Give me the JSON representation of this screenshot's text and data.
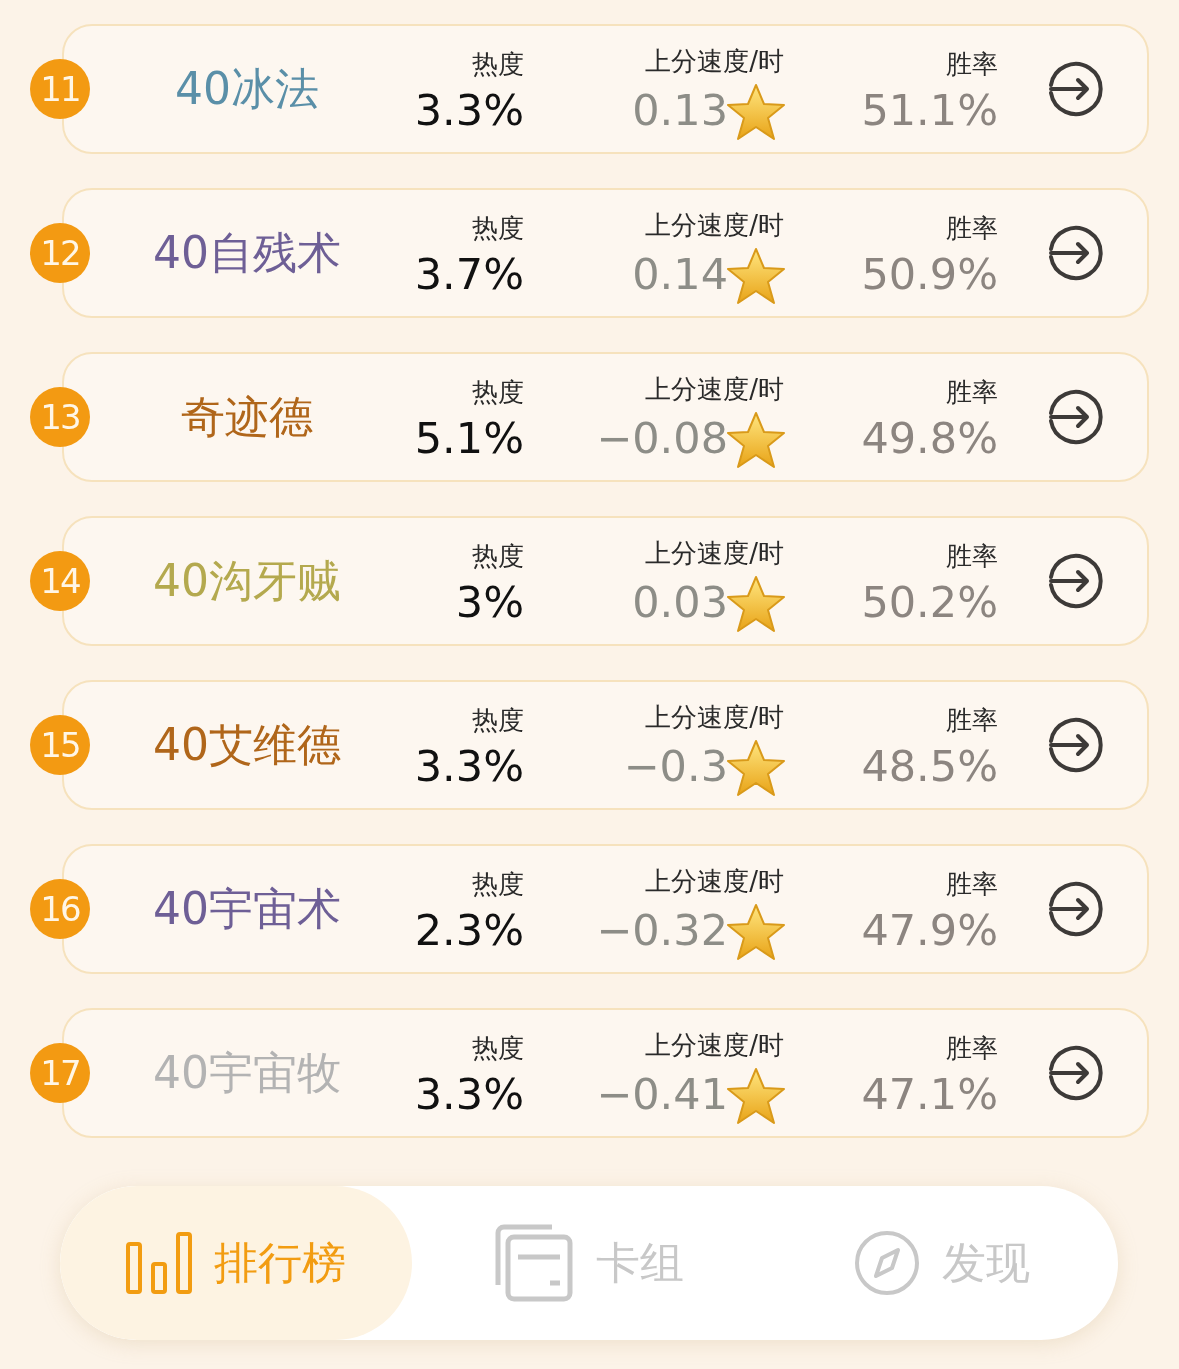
{
  "rows": [
    {
      "rank": "11",
      "name": "40冰法",
      "color": "#5a8fa8",
      "heat_label": "热度",
      "heat": "3.3%",
      "speed_label": "上分速度/时",
      "speed": "0.13",
      "winrate_label": "胜率",
      "winrate": "51.1%"
    },
    {
      "rank": "12",
      "name": "40自残术",
      "color": "#6e5f96",
      "heat_label": "热度",
      "heat": "3.7%",
      "speed_label": "上分速度/时",
      "speed": "0.14",
      "winrate_label": "胜率",
      "winrate": "50.9%"
    },
    {
      "rank": "13",
      "name": "奇迹德",
      "color": "#b0661a",
      "heat_label": "热度",
      "heat": "5.1%",
      "speed_label": "上分速度/时",
      "speed": "−0.08",
      "winrate_label": "胜率",
      "winrate": "49.8%"
    },
    {
      "rank": "14",
      "name": "40沟牙贼",
      "color": "#b4a94e",
      "heat_label": "热度",
      "heat": "3%",
      "speed_label": "上分速度/时",
      "speed": "0.03",
      "winrate_label": "胜率",
      "winrate": "50.2%"
    },
    {
      "rank": "15",
      "name": "40艾维德",
      "color": "#b0661a",
      "heat_label": "热度",
      "heat": "3.3%",
      "speed_label": "上分速度/时",
      "speed": "−0.3",
      "winrate_label": "胜率",
      "winrate": "48.5%"
    },
    {
      "rank": "16",
      "name": "40宇宙术",
      "color": "#6e5f96",
      "heat_label": "热度",
      "heat": "2.3%",
      "speed_label": "上分速度/时",
      "speed": "−0.32",
      "winrate_label": "胜率",
      "winrate": "47.9%"
    },
    {
      "rank": "17",
      "name": "40宇宙牧",
      "color": "#b3b3b3",
      "heat_label": "热度",
      "heat": "3.3%",
      "speed_label": "上分速度/时",
      "speed": "−0.41",
      "winrate_label": "胜率",
      "winrate": "47.1%"
    }
  ],
  "nav": [
    {
      "kind": "ranking",
      "label": "排行榜",
      "selected": true
    },
    {
      "kind": "decks",
      "label": "卡组",
      "selected": false
    },
    {
      "kind": "discover",
      "label": "发现",
      "selected": false
    }
  ]
}
